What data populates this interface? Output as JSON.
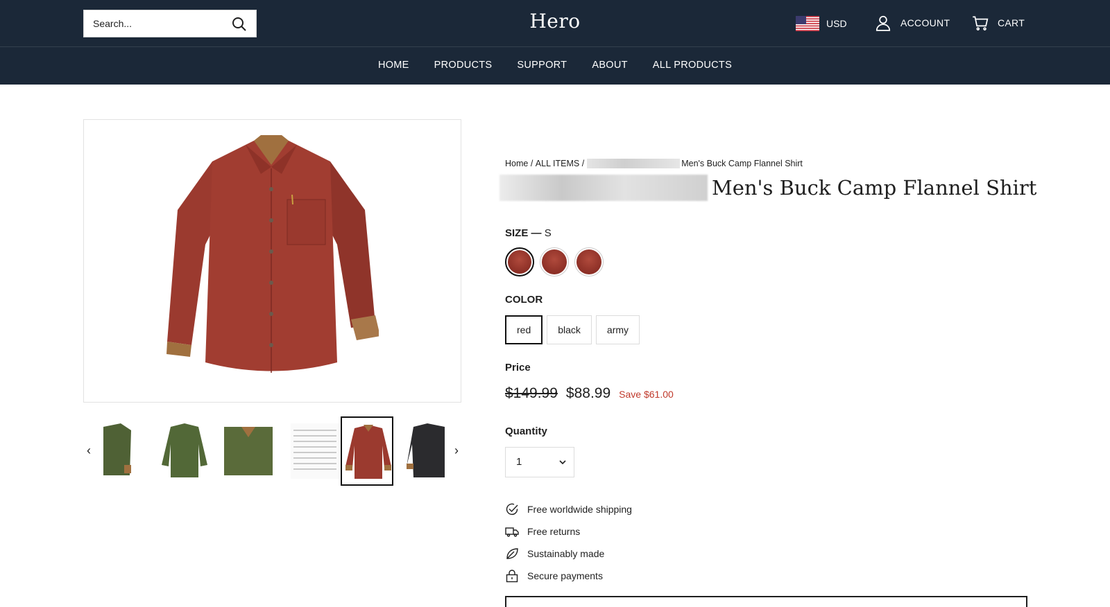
{
  "header": {
    "search_placeholder": "Search...",
    "logo": "Hero",
    "currency": "USD",
    "account_label": "ACCOUNT",
    "cart_label": "CART"
  },
  "nav": {
    "items": [
      {
        "label": "HOME"
      },
      {
        "label": "PRODUCTS"
      },
      {
        "label": "SUPPORT"
      },
      {
        "label": "ABOUT"
      },
      {
        "label": "ALL PRODUCTS"
      }
    ]
  },
  "gallery": {
    "prev_arrow": "‹",
    "next_arrow": "›",
    "thumbnails": [
      {
        "color": "#4f6135"
      },
      {
        "color": "#526837"
      },
      {
        "color": "#5a6b3a"
      },
      {
        "color": "#f4f4f4"
      },
      {
        "color": "#9b3a2f",
        "selected": true
      },
      {
        "color": "#2b2b2e"
      }
    ]
  },
  "product": {
    "breadcrumb": {
      "home": "Home",
      "sep1": "/",
      "all_items": "ALL ITEMS",
      "sep2": "/",
      "current": "Men's Buck Camp Flannel Shirt"
    },
    "title": "Men's Buck Camp Flannel Shirt",
    "size_label": "SIZE",
    "size_sep": "—",
    "size_value": "S",
    "color_label": "COLOR",
    "colors": [
      {
        "label": "red",
        "selected": true
      },
      {
        "label": "black"
      },
      {
        "label": "army"
      }
    ],
    "price_label": "Price",
    "original_price": "$149.99",
    "sale_price": "$88.99",
    "savings": "Save $61.00",
    "quantity_label": "Quantity",
    "quantity_value": "1",
    "features": [
      {
        "icon": "check-circle-icon",
        "label": "Free worldwide shipping"
      },
      {
        "icon": "truck-icon",
        "label": "Free returns"
      },
      {
        "icon": "leaf-icon",
        "label": "Sustainably made"
      },
      {
        "icon": "lock-icon",
        "label": "Secure payments"
      }
    ]
  },
  "colors": {
    "header_bg": "#1b2838",
    "shirt_red": "#9b3a2f",
    "save_red": "#c0392b"
  }
}
